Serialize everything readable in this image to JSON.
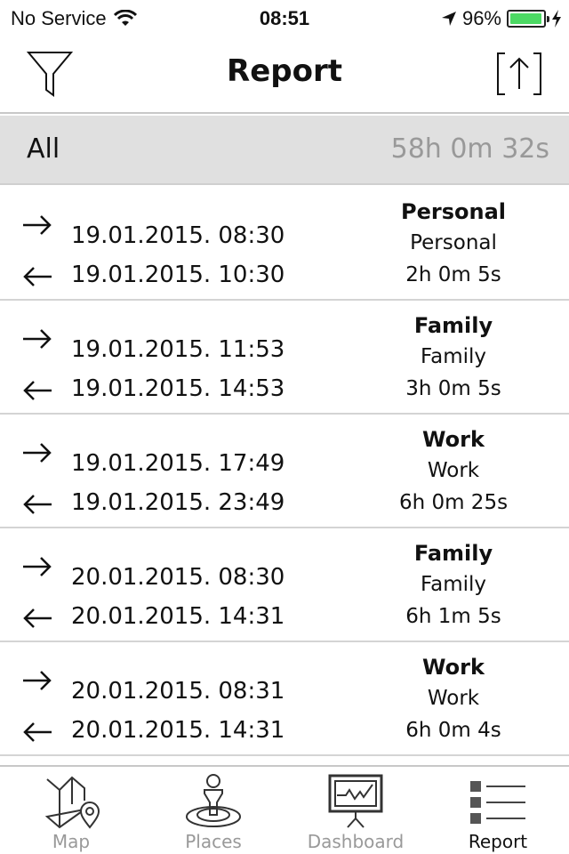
{
  "status_bar": {
    "carrier": "No Service",
    "time": "08:51",
    "battery_percent_label": "96%",
    "battery_level": 0.96,
    "battery_color": "#4cd964"
  },
  "nav": {
    "title": "Report",
    "left_icon": "filter-icon",
    "right_icon": "share-export-icon"
  },
  "summary": {
    "label": "All",
    "total": "58h 0m 32s"
  },
  "entries": [
    {
      "arrival": "19.01.2015. 08:30",
      "departure": "19.01.2015. 10:30",
      "category": "Personal",
      "place": "Personal",
      "duration": "2h 0m 5s"
    },
    {
      "arrival": "19.01.2015. 11:53",
      "departure": "19.01.2015. 14:53",
      "category": "Family",
      "place": "Family",
      "duration": "3h 0m 5s"
    },
    {
      "arrival": "19.01.2015. 17:49",
      "departure": "19.01.2015. 23:49",
      "category": "Work",
      "place": "Work",
      "duration": "6h 0m 25s"
    },
    {
      "arrival": "20.01.2015. 08:30",
      "departure": "20.01.2015. 14:31",
      "category": "Family",
      "place": "Family",
      "duration": "6h 1m 5s"
    },
    {
      "arrival": "20.01.2015. 08:31",
      "departure": "20.01.2015. 14:31",
      "category": "Work",
      "place": "Work",
      "duration": "6h 0m 4s"
    }
  ],
  "tabs": [
    {
      "label": "Map",
      "icon": "map-icon",
      "active": false
    },
    {
      "label": "Places",
      "icon": "places-icon",
      "active": false
    },
    {
      "label": "Dashboard",
      "icon": "dashboard-icon",
      "active": false
    },
    {
      "label": "Report",
      "icon": "report-list-icon",
      "active": true
    }
  ]
}
